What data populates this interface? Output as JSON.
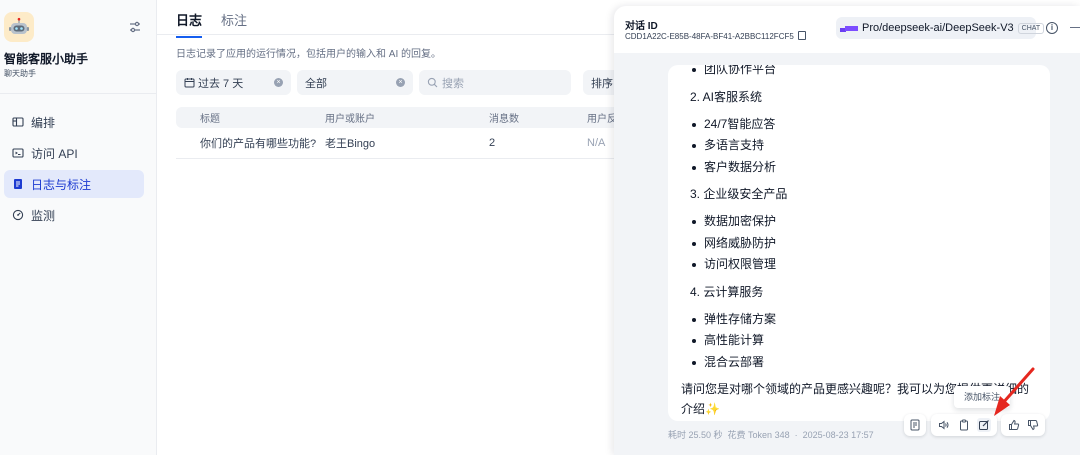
{
  "app": {
    "name": "智能客服小助手",
    "type": "聊天助手"
  },
  "sidebar": {
    "items": [
      {
        "label": "编排",
        "icon": "layout-icon",
        "active": false
      },
      {
        "label": "访问 API",
        "icon": "terminal-icon",
        "active": false
      },
      {
        "label": "日志与标注",
        "icon": "document-icon",
        "active": true
      },
      {
        "label": "监测",
        "icon": "dashboard-icon",
        "active": false
      }
    ]
  },
  "tabs": [
    {
      "label": "日志",
      "active": true
    },
    {
      "label": "标注",
      "active": false
    }
  ],
  "description": "日志记录了应用的运行情况，包括用户的输入和 AI 的回复。",
  "filters": {
    "date": "过去 7 天",
    "status": "全部",
    "search_placeholder": "搜索",
    "sort": "排序"
  },
  "table": {
    "headers": [
      "标题",
      "用户或账户",
      "消息数",
      "用户反"
    ],
    "rows": [
      {
        "title": "你们的产品有哪些功能?",
        "user": "老王Bingo",
        "messages": "2",
        "feedback": "N/A"
      }
    ]
  },
  "drawer": {
    "conversation_label": "对话 ID",
    "conversation_id": "CDD1A22C-E85B-48FA-BF41-A2BBC112FCF5",
    "model_name": "Pro/deepseek-ai/DeepSeek-V3",
    "model_mode": "CHAT",
    "message": {
      "top_item": "团队协作平台",
      "sections": [
        {
          "heading": "2. AI客服系统",
          "items": [
            "24/7智能应答",
            "多语言支持",
            "客户数据分析"
          ]
        },
        {
          "heading": "3. 企业级安全产品",
          "items": [
            "数据加密保护",
            "网络威胁防护",
            "访问权限管理"
          ]
        },
        {
          "heading": "4. 云计算服务",
          "items": [
            "弹性存储方案",
            "高性能计算",
            "混合云部署"
          ]
        }
      ],
      "closing": "请问您是对哪个领域的产品更感兴趣呢？我可以为您提供更详细的介绍",
      "sparkle": "✨"
    },
    "meta": {
      "elapsed": "耗时 25.50 秒",
      "tokens": "花费 Token 348",
      "separator": "·",
      "timestamp": "2025-08-23 17:57"
    },
    "tooltip": "添加标注"
  },
  "colors": {
    "accent": "#155eef",
    "nav_active_bg": "#e3e9fb",
    "arrow": "#e5271f",
    "app_icon_bg": "#fdebc8"
  }
}
